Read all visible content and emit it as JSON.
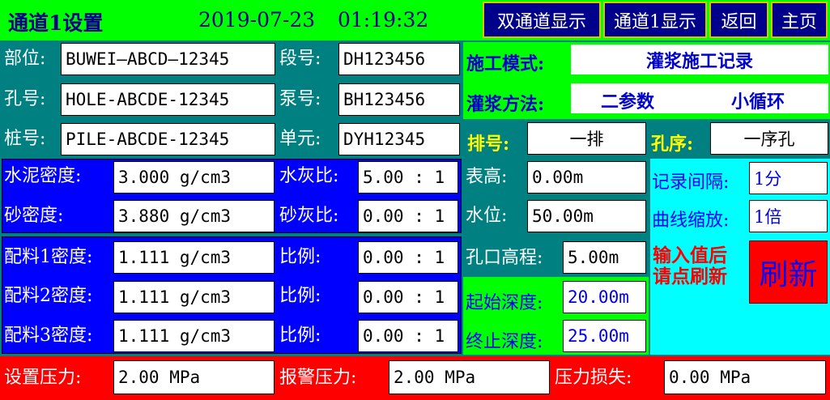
{
  "header": {
    "title": "通道1设置",
    "date": "2019-07-23",
    "time": "01:19:32",
    "buttons": [
      "双通道显示",
      "通道1显示",
      "返回",
      "主页"
    ]
  },
  "info": {
    "location": {
      "label": "部位:",
      "value": "BUWEI—ABCD—12345"
    },
    "section": {
      "label": "段号:",
      "value": "DH123456"
    },
    "hole": {
      "label": "孔号:",
      "value": "HOLE-ABCDE-12345"
    },
    "pump": {
      "label": "泵号:",
      "value": "BH123456"
    },
    "pile": {
      "label": "桩号:",
      "value": "PILE-ABCDE-12345"
    },
    "unit": {
      "label": "单元:",
      "value": "DYH12345"
    }
  },
  "mode": {
    "construction_label": "施工模式:",
    "construction_value": "灌浆施工记录",
    "method_label": "灌浆方法:",
    "method_value1": "二参数",
    "method_value2": "小循环"
  },
  "row_order": {
    "label": "排号:",
    "value": "一排"
  },
  "hole_order": {
    "label": "孔序:",
    "value": "一序孔"
  },
  "densities": {
    "cement_label": "水泥密度:",
    "cement_value": "3.000 g/cm3",
    "wc_label": "水灰比:",
    "wc_value": "5.00 : 1",
    "sand_label": "砂密度:",
    "sand_value": "3.880 g/cm3",
    "sc_label": "砂灰比:",
    "sc_value": "0.00 : 1"
  },
  "materials": [
    {
      "label": "配料1密度:",
      "value": "1.111 g/cm3",
      "ratio_label": "比例:",
      "ratio": "0.00 : 1"
    },
    {
      "label": "配料2密度:",
      "value": "1.111 g/cm3",
      "ratio_label": "比例:",
      "ratio": "0.00 : 1"
    },
    {
      "label": "配料3密度:",
      "value": "1.111 g/cm3",
      "ratio_label": "比例:",
      "ratio": "0.00 : 1"
    }
  ],
  "gauge": {
    "meter_height_label": "表高:",
    "meter_height": "0.00m",
    "water_level_label": "水位:",
    "water_level": "50.00m",
    "elevation_label": "孔口高程:",
    "elevation": "5.00m",
    "start_depth_label": "起始深度:",
    "start_depth": "20.00m",
    "end_depth_label": "终止深度:",
    "end_depth": "25.00m"
  },
  "record": {
    "interval_label": "记录间隔:",
    "interval": "1分",
    "zoom_label": "曲线缩放:",
    "zoom": "1倍",
    "hint": "输入值后请点刷新",
    "refresh_label": "刷新"
  },
  "pressure": {
    "set_label": "设置压力:",
    "set_value": "2.00 MPa",
    "alarm_label": "报警压力:",
    "alarm_value": "2.00 MPa",
    "loss_label": "压力损失:",
    "loss_value": "0.00 MPa"
  },
  "colors": {
    "header_bg": "#00ff00",
    "teal": "#008080",
    "blue_panel": "#0000ff",
    "green_panel": "#00ff00",
    "cyan_panel": "#00ffff",
    "red_bar": "#ff0000",
    "yellow_text": "#ffff00"
  }
}
